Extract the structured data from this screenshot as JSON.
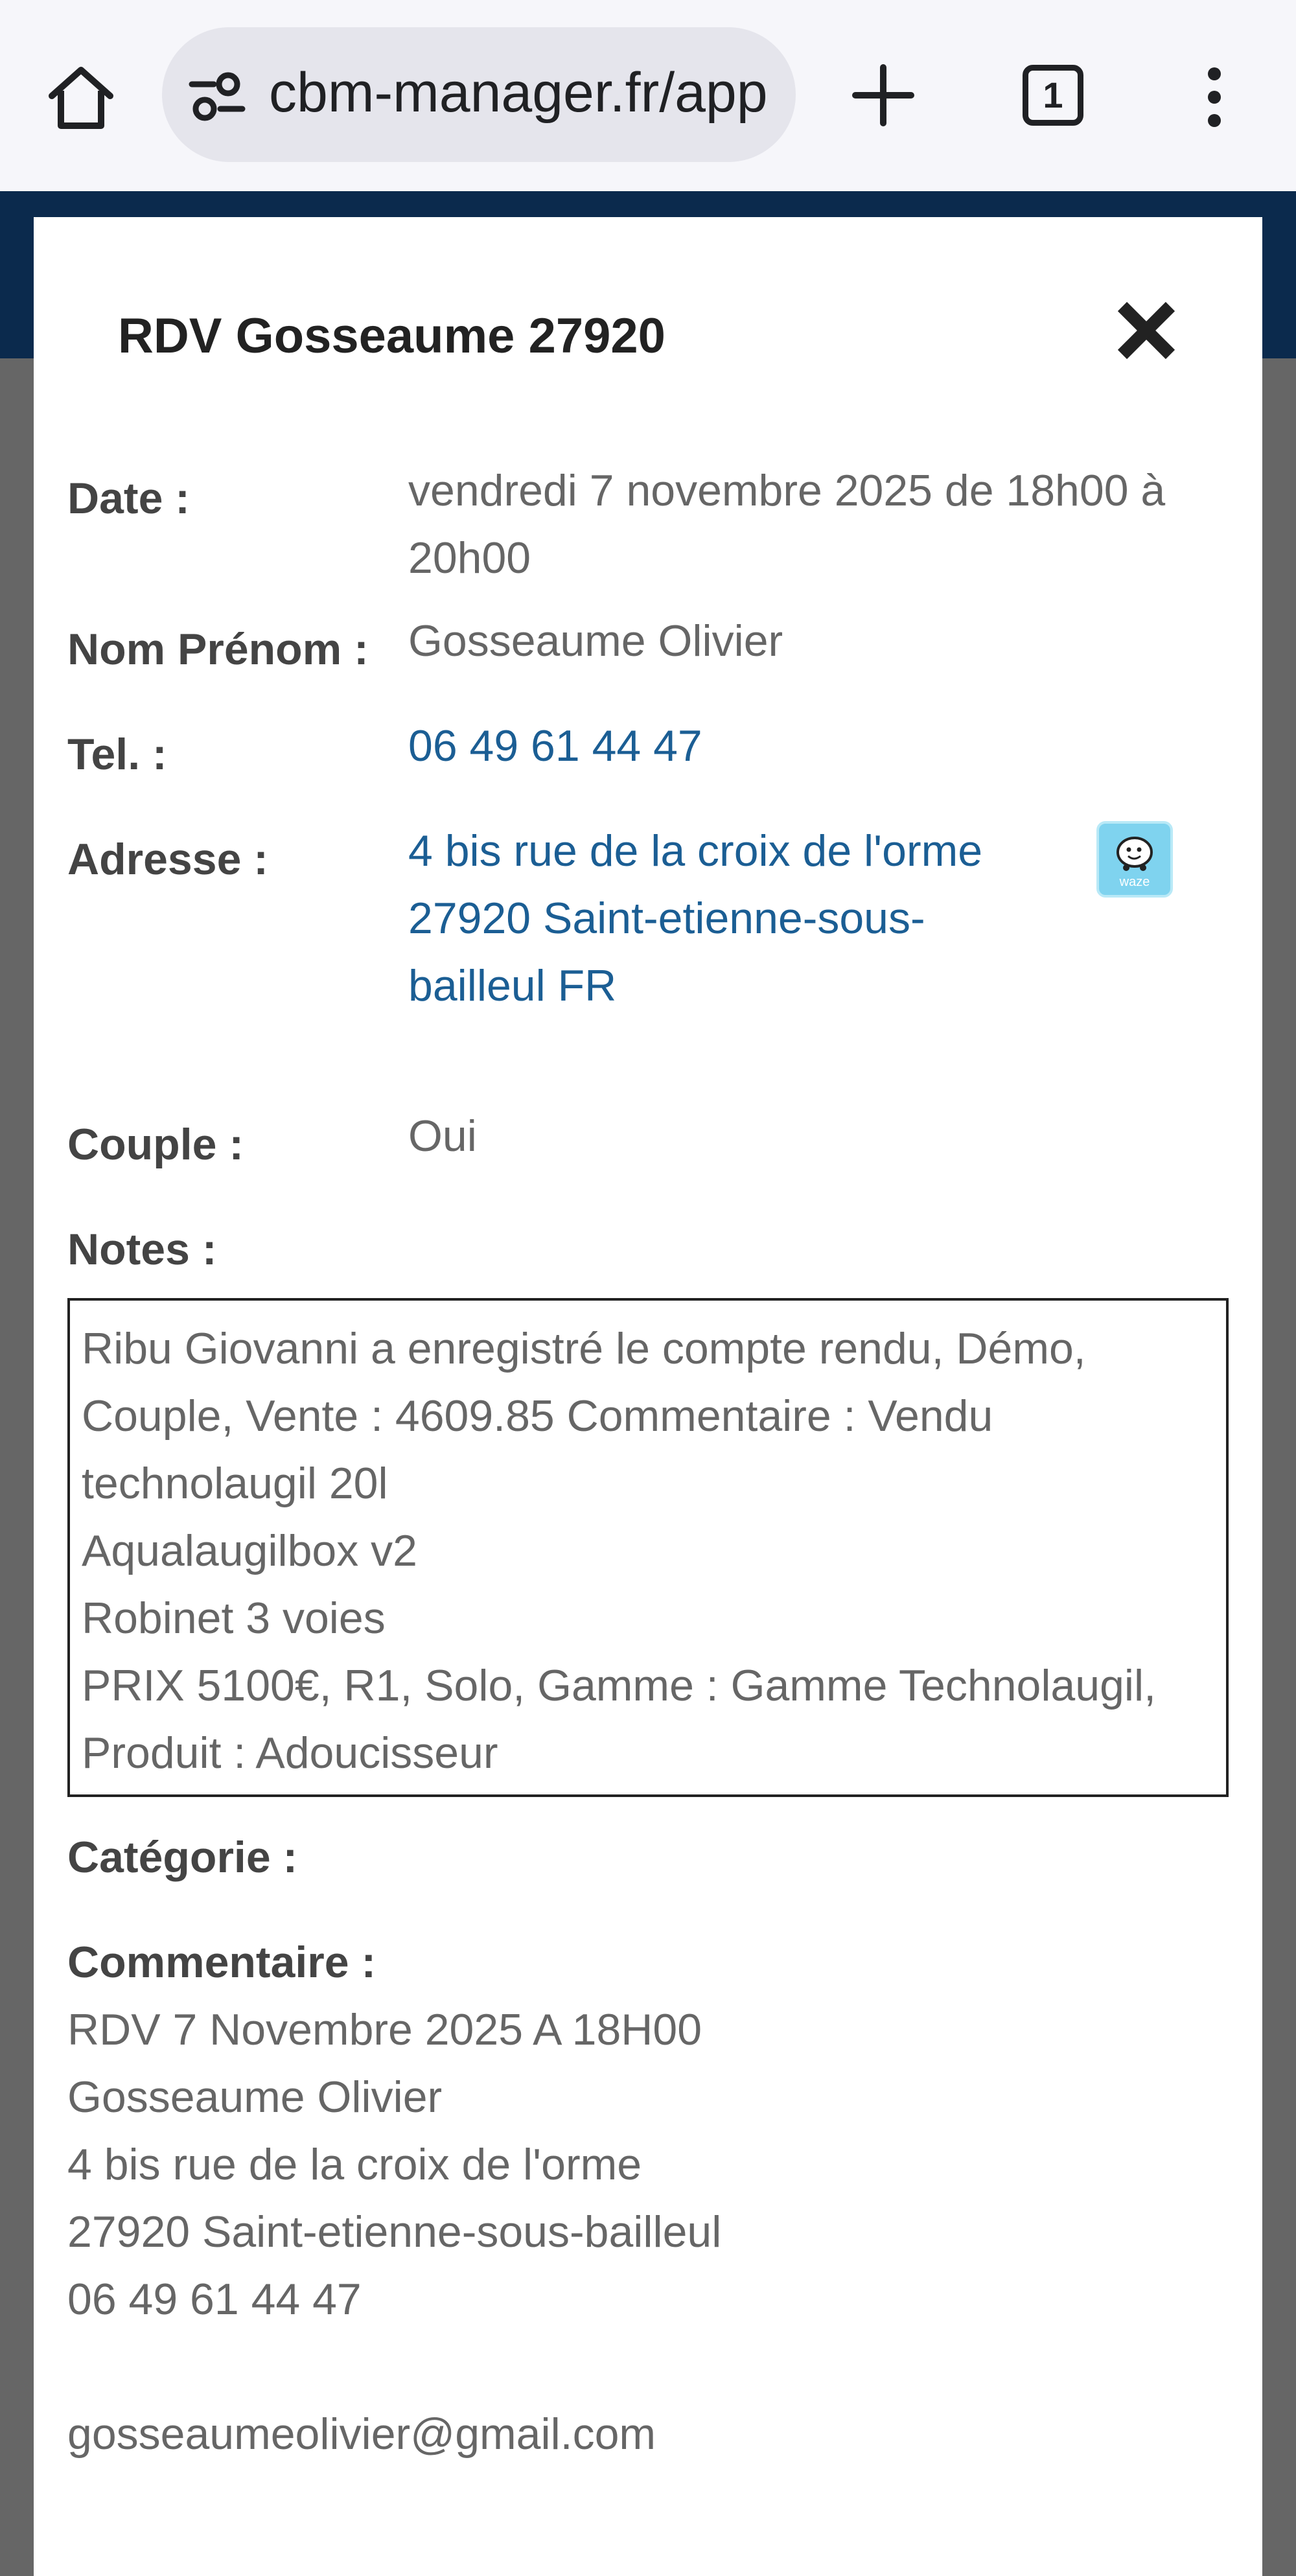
{
  "browser": {
    "url": "cbm-manager.fr/app",
    "tab_count": "1"
  },
  "modal": {
    "title": "RDV Gosseaume 27920",
    "date_label": "Date :",
    "date_value_line1": "vendredi 7 novembre 2025 de 18h00 à",
    "date_value_line2": "20h00",
    "name_label": "Nom Prénom :",
    "name_value": "Gosseaume Olivier",
    "tel_label": "Tel. :",
    "tel_value": "06 49 61 44 47",
    "address_label": "Adresse :",
    "address_line1": "4 bis rue de la croix de l'orme",
    "address_line2": "27920 Saint-etienne-sous-",
    "address_line3": "bailleul FR",
    "waze_text": "waze",
    "couple_label": "Couple :",
    "couple_value": "Oui",
    "notes_label": "Notes :",
    "notes_lines": [
      "Ribu Giovanni a enregistré le compte rendu, Démo,",
      "Couple, Vente : 4609.85 Commentaire : Vendu",
      "technolaugil 20l",
      "Aqualaugilbox v2",
      "Robinet 3 voies",
      "PRIX 5100€, R1, Solo, Gamme : Gamme Technolaugil,",
      "Produit : Adoucisseur"
    ],
    "category_label": "Catégorie :",
    "comment_label": "Commentaire :",
    "comment_lines": [
      "RDV 7 Novembre 2025 A 18H00",
      "Gosseaume Olivier",
      "4 bis rue de la croix de l'orme",
      "27920 Saint-etienne-sous-bailleul",
      "06 49 61 44 47",
      "",
      "gosseaumeolivier@gmail.com"
    ]
  },
  "colors": {
    "link": "#1b5e94",
    "header_navy": "#0b2a4d",
    "overlay": "#666666"
  }
}
